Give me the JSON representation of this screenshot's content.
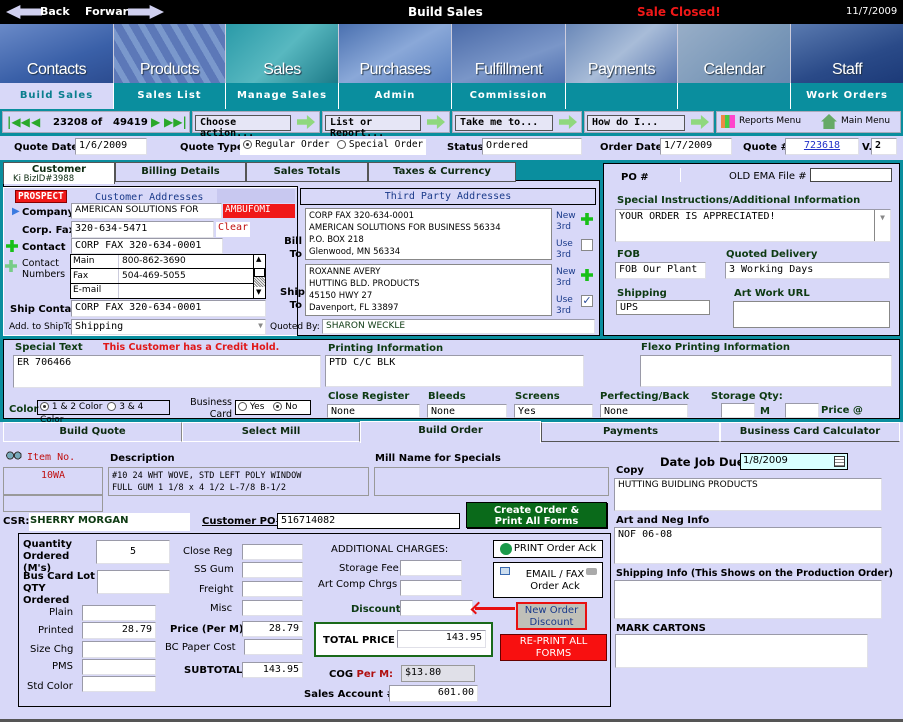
{
  "topbar": {
    "back": "Back",
    "forward": "Forwar",
    "title": "Build Sales",
    "status": "Sale Closed!",
    "date": "11/7/2009"
  },
  "nav_images": [
    "Contacts",
    "Products",
    "Sales",
    "Purchases",
    "Fulfillment",
    "Payments",
    "Calendar",
    "Staff"
  ],
  "subnav": [
    "Build Sales",
    "Sales List",
    "Manage Sales",
    "Admin",
    "Commission",
    "",
    "",
    "Work Orders"
  ],
  "toolbar": {
    "record_current": "23208",
    "record_of": "of",
    "record_total": "49419",
    "choose_action": "Choose action...",
    "list_report": "List or Report...",
    "take_me_to": "Take me to...",
    "how_do_i": "How do I...",
    "reports_menu": "Reports Menu",
    "main_menu": "Main Menu"
  },
  "quote_row": {
    "quote_date_label": "Quote Date:",
    "quote_date": "1/6/2009",
    "quote_type_label": "Quote Type:",
    "regular": "Regular Order",
    "special": "Special Order",
    "status_label": "Status:",
    "status": "Ordered",
    "order_date_label": "Order Date:",
    "order_date": "1/7/2009",
    "quote_no_label": "Quote #",
    "quote_no": "723618",
    "version_label": "V.",
    "version": "2"
  },
  "customer_tabs": [
    "Customer",
    "Billing Details",
    "Sales Totals",
    "Taxes & Currency"
  ],
  "customer": {
    "bizid": "Ki BizID#3988",
    "prospect": "PROSPECT",
    "addresses_label": "Customer Addresses",
    "company_label": "Company",
    "company": "AMERICAN SOLUTIONS FOR",
    "company_code": "AMBUFOMI",
    "corp_fax_label": "Corp. Fax",
    "corp_fax": "320-634-5471",
    "clear": "Clear",
    "contact_label": "Contact",
    "contact": "CORP FAX 320-634-0001",
    "contact_numbers_label": "Contact Numbers",
    "numbers": [
      {
        "type": "Main",
        "value": "800-862-3690"
      },
      {
        "type": "Fax",
        "value": "504-469-5055"
      },
      {
        "type": "E-mail",
        "value": ""
      }
    ],
    "ship_contact_label": "Ship Contact",
    "ship_contact": "CORP FAX 320-634-0001",
    "add_ship_label": "Add. to ShipTo",
    "add_ship": "Shipping"
  },
  "third_party": {
    "title": "Third Party Addresses",
    "bill_label": "Bill To",
    "bill_lines": [
      "CORP FAX 320-634-0001",
      "AMERICAN SOLUTIONS FOR BUSINESS 56334",
      "P.O. BOX 218",
      "Glenwood, MN 56334"
    ],
    "ship_label": "Ship To",
    "ship_lines": [
      "ROXANNE AVERY",
      "HUTTING BLD. PRODUCTS",
      "45150 HWY 27",
      "Davenport, FL 33897"
    ],
    "new_3rd": "New 3rd",
    "use_3rd": "Use 3rd",
    "quoted_by_label": "Quoted By:",
    "quoted_by": "SHARON WECKLE"
  },
  "right_panel": {
    "po_label": "PO #",
    "old_ema_label": "OLD EMA File #",
    "old_ema": "",
    "special_instr_label": "Special Instructions/Additional Information",
    "special_instr": "YOUR ORDER IS APPRECIATED!",
    "fob_label": "FOB",
    "fob": "FOB Our Plant -",
    "quoted_delivery_label": "Quoted Delivery",
    "quoted_delivery": "3 Working Days",
    "shipping_label": "Shipping",
    "shipping": "UPS",
    "artwork_label": "Art Work URL",
    "artwork": ""
  },
  "printing": {
    "special_text_label": "Special Text",
    "credit_hold": "This Customer has a Credit Hold.",
    "special_text": "ER 706466",
    "printing_info_label": "Printing Information",
    "printing_info": "PTD C/C BLK",
    "flexo_label": "Flexo Printing Information",
    "flexo": "",
    "color_label": "Color",
    "color_opt1": "1 & 2 Color",
    "color_opt2": "3 & 4 Color",
    "bizcard_label": "Business Card",
    "yes": "Yes",
    "no": "No",
    "close_register_label": "Close Register",
    "close_register": "None",
    "bleeds_label": "Bleeds",
    "bleeds": "None",
    "screens_label": "Screens",
    "screens": "Yes",
    "perfecting_label": "Perfecting/Back",
    "perfecting": "None",
    "storage_qty_label": "Storage Qty:",
    "m_label": "M",
    "price_at_label": "Price @"
  },
  "order_tabs": [
    "Build Quote",
    "Select Mill",
    "Build Order",
    "Payments",
    "Business Card Calculator"
  ],
  "order": {
    "item_no_label": "Item No.",
    "item_no": "10WA",
    "description_label": "Description",
    "description": [
      "#10 24 WHT WOVE, STD LEFT POLY WINDOW",
      "FULL GUM 1 1/8 x 4 1/2 L-7/8 B-1/2"
    ],
    "mill_label": "Mill Name for Specials",
    "date_due_label": "Date Job Due:",
    "date_due": "1/8/2009",
    "csr_label": "CSR:",
    "csr": "SHERRY MORGAN",
    "customer_po_label": "Customer PO#",
    "customer_po": "516714082",
    "create_order": "Create Order & Print All Forms",
    "copy_label": "Copy",
    "copy": "HUTTING BUIDLING PRODUCTS",
    "art_neg_label": "Art and Neg Info",
    "art_neg": "NOF 06-08",
    "shipping_info_label": "Shipping Info (This Shows on the Production Order)",
    "mark_cartons_label": "MARK CARTONS"
  },
  "pricing": {
    "qty_label": "Quantity Ordered (M's)",
    "qty": "5",
    "buscard_lot_label": "Bus Card Lot QTY Ordered",
    "plain_label": "Plain",
    "plain": "",
    "printed_label": "Printed",
    "printed": "28.79",
    "size_chg_label": "Size Chg",
    "pms_label": "PMS",
    "std_color_label": "Std Color",
    "close_reg_label": "Close Reg",
    "ss_gum_label": "SS Gum",
    "freight_label": "Freight",
    "misc_label": "Misc",
    "price_per_m_label": "Price (Per M)",
    "price_per_m": "28.79",
    "bc_paper_label": "BC Paper Cost",
    "subtotal_label": "SUBTOTAL",
    "subtotal": "143.95",
    "additional_label": "ADDITIONAL CHARGES:",
    "storage_fee_label": "Storage Fee",
    "art_comp_label": "Art Comp Chrgs",
    "discount_label": "Discount",
    "total_label": "TOTAL PRICE",
    "total": "143.95",
    "cog_label": "COG",
    "cog_per_m": "Per M:",
    "cog": "$13.80",
    "sales_account_label": "Sales Account #",
    "sales_account": "601.00",
    "print_ack": "PRINT Order Ack",
    "email_fax_ack": "EMAIL / FAX Order Ack",
    "new_discount": "New Order Discount",
    "reprint": "RE-PRINT ALL FORMS"
  }
}
